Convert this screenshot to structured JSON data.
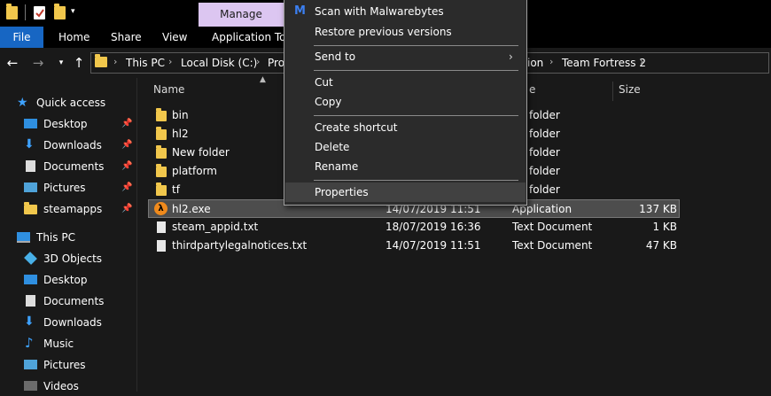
{
  "ribbon": {
    "manage_tab": "Manage",
    "tabs": [
      "File",
      "Home",
      "Share",
      "View",
      "Application Too"
    ]
  },
  "address": {
    "crumbs": [
      "This PC",
      "Local Disk (C:)",
      "Pro",
      "ion",
      "Team Fortress 2"
    ]
  },
  "nav": {
    "quick_access": "Quick access",
    "quick_items": [
      "Desktop",
      "Downloads",
      "Documents",
      "Pictures",
      "steamapps"
    ],
    "this_pc": "This PC",
    "pc_items": [
      "3D Objects",
      "Desktop",
      "Documents",
      "Downloads",
      "Music",
      "Pictures",
      "Videos"
    ]
  },
  "columns": {
    "name": "Name",
    "type": "e",
    "size": "Size"
  },
  "files": [
    {
      "name": "bin",
      "date": "",
      "type": "folder",
      "size": ""
    },
    {
      "name": "hl2",
      "date": "",
      "type": "folder",
      "size": ""
    },
    {
      "name": "New folder",
      "date": "",
      "type": "folder",
      "size": ""
    },
    {
      "name": "platform",
      "date": "",
      "type": "folder",
      "size": ""
    },
    {
      "name": "tf",
      "date": "",
      "type": "folder",
      "size": ""
    },
    {
      "name": "hl2.exe",
      "date": "14/07/2019 11:51",
      "type": "Application",
      "size": "137 KB"
    },
    {
      "name": "steam_appid.txt",
      "date": "18/07/2019 16:36",
      "type": "Text Document",
      "size": "1 KB"
    },
    {
      "name": "thirdpartylegalnotices.txt",
      "date": "14/07/2019 11:51",
      "type": "Text Document",
      "size": "47 KB"
    }
  ],
  "context_menu": {
    "scan": "Scan with Malwarebytes",
    "restore": "Restore previous versions",
    "send_to": "Send to",
    "cut": "Cut",
    "copy": "Copy",
    "create_shortcut": "Create shortcut",
    "delete": "Delete",
    "rename": "Rename",
    "properties": "Properties"
  },
  "colors": {
    "accent": "#1766c3",
    "manage_tab": "#dcc6f1",
    "folder": "#f1c74c"
  }
}
